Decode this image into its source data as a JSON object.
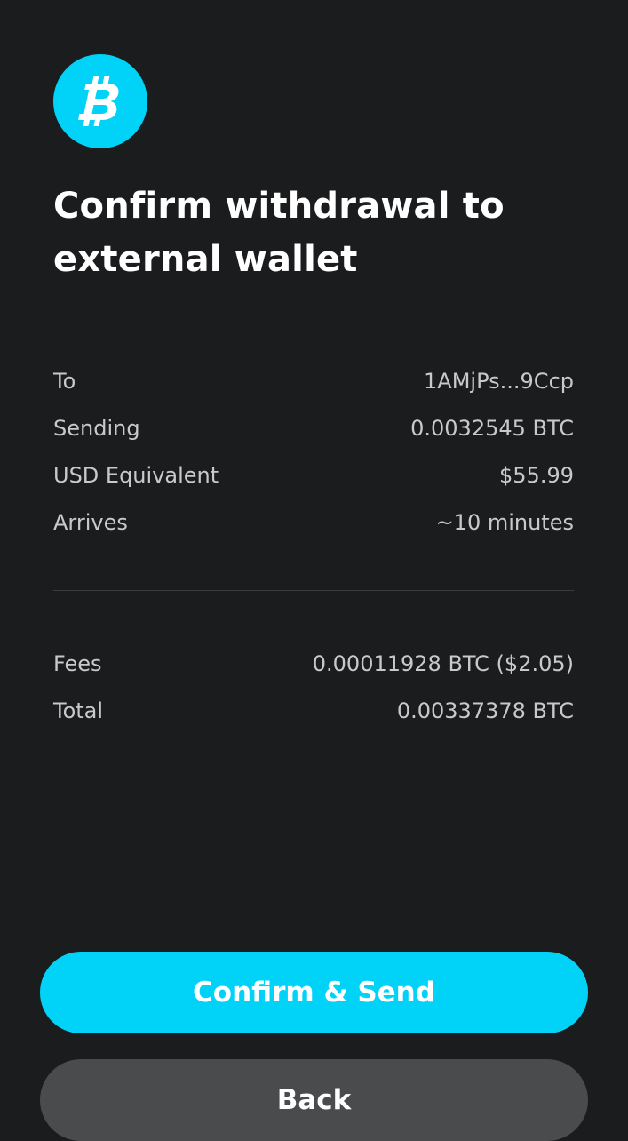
{
  "header": {
    "icon": "bitcoin-icon",
    "brand_color": "#00d3f7",
    "title": "Confirm withdrawal to external wallet"
  },
  "details": [
    {
      "label": "To",
      "value": "1AMjPs...9Ccp"
    },
    {
      "label": "Sending",
      "value": "0.0032545 BTC"
    },
    {
      "label": "USD Equivalent",
      "value": "$55.99"
    },
    {
      "label": "Arrives",
      "value": "~10 minutes"
    }
  ],
  "summary": [
    {
      "label": "Fees",
      "value": "0.00011928 BTC ($2.05)"
    },
    {
      "label": "Total",
      "value": "0.00337378 BTC"
    }
  ],
  "actions": {
    "confirm_label": "Confirm & Send",
    "back_label": "Back"
  }
}
